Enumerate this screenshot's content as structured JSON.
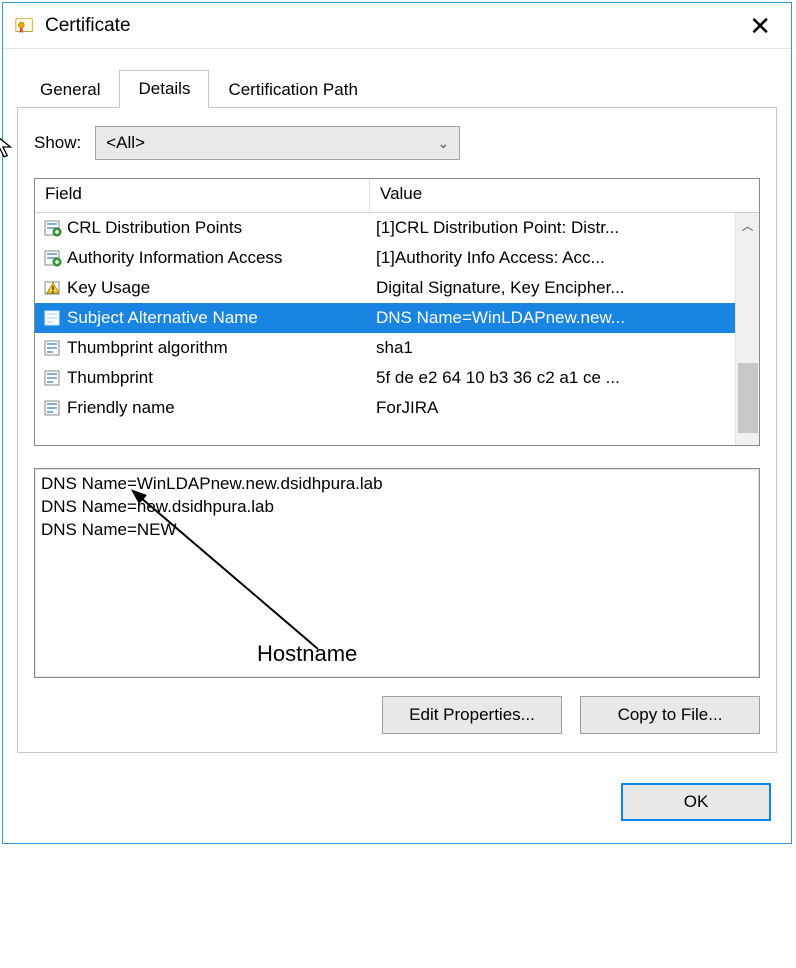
{
  "title": "Certificate",
  "tabs": {
    "general": "General",
    "details": "Details",
    "certpath": "Certification Path"
  },
  "show": {
    "label": "Show:",
    "value": "<All>"
  },
  "columns": {
    "field": "Field",
    "value": "Value"
  },
  "rows": [
    {
      "field": "CRL Distribution Points",
      "value": "[1]CRL Distribution Point: Distr...",
      "icon": "ext"
    },
    {
      "field": "Authority Information Access",
      "value": "[1]Authority Info Access: Acc...",
      "icon": "ext"
    },
    {
      "field": "Key Usage",
      "value": "Digital Signature, Key Encipher...",
      "icon": "warn"
    },
    {
      "field": "Subject Alternative Name",
      "value": "DNS Name=WinLDAPnew.new...",
      "icon": "prop",
      "selected": true
    },
    {
      "field": "Thumbprint algorithm",
      "value": "sha1",
      "icon": "prop"
    },
    {
      "field": "Thumbprint",
      "value": "5f de e2 64 10 b3 36 c2 a1 ce ...",
      "icon": "prop"
    },
    {
      "field": "Friendly name",
      "value": "ForJIRA",
      "icon": "prop"
    }
  ],
  "detail_lines": [
    "DNS Name=WinLDAPnew.new.dsidhpura.lab",
    "DNS Name=new.dsidhpura.lab",
    "DNS Name=NEW"
  ],
  "buttons": {
    "edit": "Edit Properties...",
    "copy": "Copy to File...",
    "ok": "OK"
  },
  "annotation": "Hostname"
}
